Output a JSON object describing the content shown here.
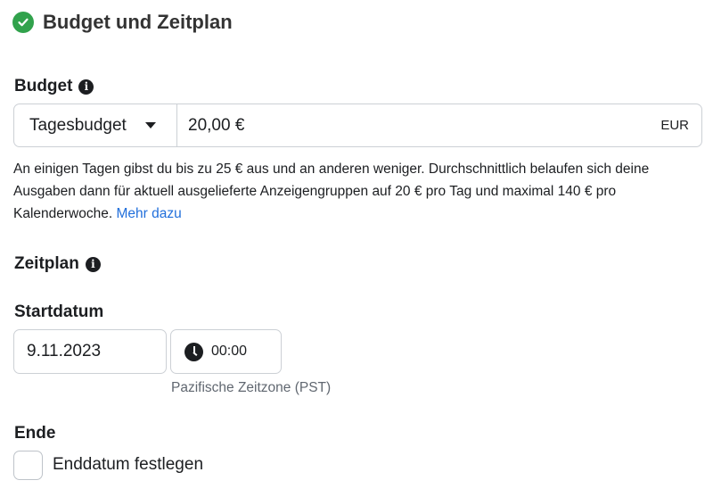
{
  "section": {
    "title": "Budget und Zeitplan",
    "icon": "check-circle-icon",
    "icon_color": "#31a24c"
  },
  "budget": {
    "label": "Budget",
    "type_selected": "Tagesbudget",
    "amount_value": "20,00 €",
    "currency": "EUR",
    "help_text": "An einigen Tagen gibst du bis zu 25 € aus und an anderen weniger. Durchschnittlich belaufen sich deine Ausgaben dann für aktuell ausgelieferte Anzeigengruppen auf 20 € pro Tag und maximal 140 € pro Kalenderwoche.",
    "help_link": "Mehr dazu"
  },
  "schedule": {
    "label": "Zeitplan",
    "start_label": "Startdatum",
    "start_date": "9.11.2023",
    "start_time": "00:00",
    "timezone": "Pazifische Zeitzone (PST)",
    "end_label": "Ende",
    "end_checkbox_label": "Enddatum festlegen",
    "end_checkbox_checked": false
  },
  "colors": {
    "link": "#216fdb",
    "border": "#ccd0d5",
    "text": "#1c1e21"
  }
}
